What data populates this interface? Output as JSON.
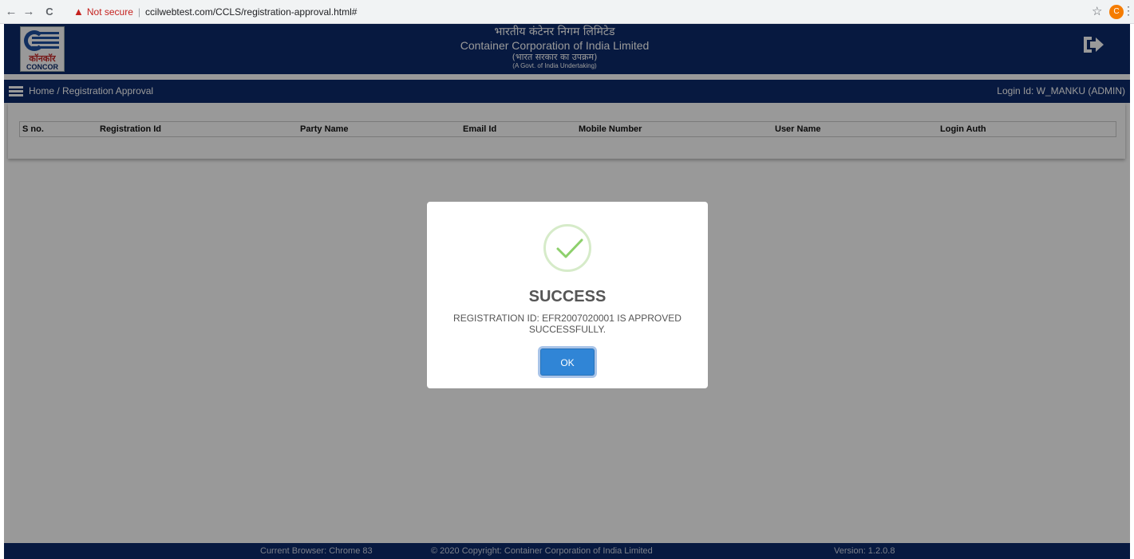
{
  "browser": {
    "back": "←",
    "forward": "→",
    "reload": "C",
    "warning_icon": "▲",
    "security_label": "Not secure",
    "separator": "|",
    "url": "ccilwebtest.com/CCLS/registration-approval.html#",
    "star": "☆",
    "profile_initial": "C",
    "menu": "⋮"
  },
  "header": {
    "title_hindi": "भारतीय कंटेनर निगम लिमिटेड",
    "title_english": "Container Corporation of India Limited",
    "subtitle_hindi": "(भारत सरकार का उपक्रम)",
    "subtitle_english": "(A Govt. of India Undertaking)",
    "logo_hindi": "कॉनकॉर",
    "logo_english": "CONCOR",
    "logout_icon": "logout-icon"
  },
  "breadcrumb": {
    "text": "Home / Registration Approval",
    "login_id": "Login Id: W_MANKU (ADMIN)"
  },
  "table": {
    "columns": [
      "S no.",
      "Registration Id",
      "Party Name",
      "Email Id",
      "Mobile Number",
      "User Name",
      "Login Auth"
    ]
  },
  "footer": {
    "browser": "Current Browser: Chrome 83",
    "copyright": "© 2020 Copyright: Container Corporation of India Limited",
    "version": "Version: 1.2.0.8"
  },
  "modal": {
    "title": "SUCCESS",
    "message": "REGISTRATION ID: EFR2007020001 IS APPROVED SUCCESSFULLY.",
    "ok_label": "OK",
    "icon": "check-icon",
    "accent_color": "#3085d6",
    "check_color": "#8dd06c"
  },
  "colors": {
    "brand": "#0d2b6b"
  }
}
